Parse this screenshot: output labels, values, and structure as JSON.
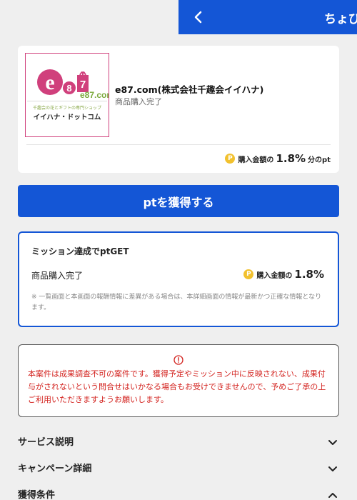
{
  "header": {
    "title": "ちょび"
  },
  "merchant": {
    "logo_domain": "e87.com",
    "logo_tagline": "千趣会の花とギフトの専門ショップ",
    "logo_name": "イイハナ・ドットコム",
    "name": "e87.com(株式会社千趣会イイハナ)",
    "subtitle": "商品購入完了",
    "reward_prefix": "購入金額の",
    "reward_value": "1.8%",
    "reward_suffix": "分のpt"
  },
  "cta": {
    "label": "ptを獲得する"
  },
  "mission": {
    "title": "ミッション達成でptGET",
    "item_label": "商品購入完了",
    "reward_prefix": "購入金額の",
    "reward_value": "1.8%",
    "note": "※ 一覧画面と本画面の報酬情報に差異がある場合は、本詳細画面の情報が最新かつ正確な情報となります。"
  },
  "warning": {
    "text": "本案件は成果調査不可の案件です。獲得予定やミッション中に反映されない、成果付与がされないという問合せはいかなる場合もお受けできませんので、予めご了承の上ご利用いただきますようお願いします。"
  },
  "accordions": [
    {
      "label": "サービス説明",
      "icon": "chevron-down-icon"
    },
    {
      "label": "キャンペーン詳細",
      "icon": "chevron-down-icon"
    },
    {
      "label": "獲得条件",
      "icon": "chevron-up-icon"
    }
  ],
  "colors": {
    "primary": "#1456d6",
    "warning": "#d3231f",
    "coin": "#f2c12e",
    "brand_pink": "#d0407c"
  }
}
